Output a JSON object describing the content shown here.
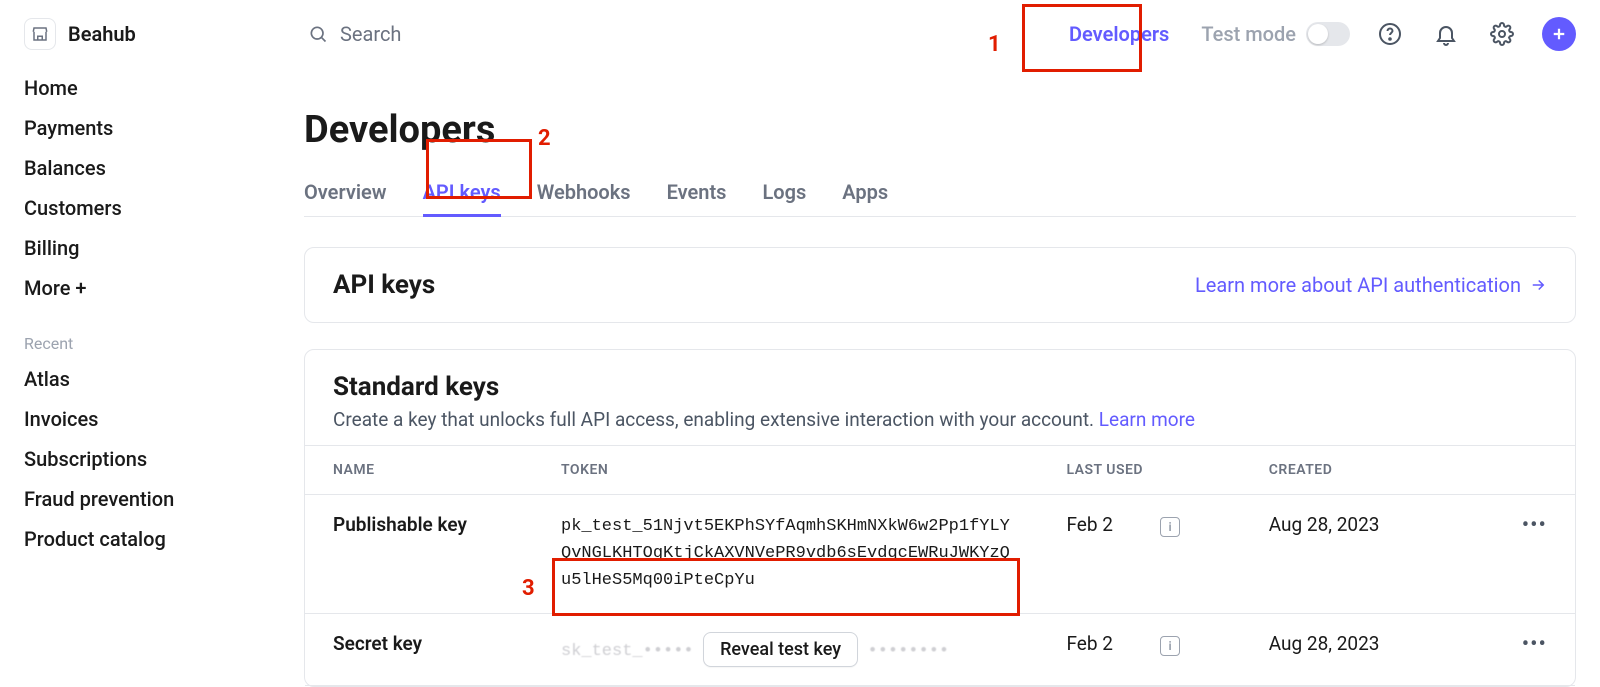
{
  "brand": "Beahub",
  "search": {
    "placeholder": "Search"
  },
  "topnav": {
    "developers": "Developers",
    "testmode": "Test mode"
  },
  "sidebar": {
    "items": [
      "Home",
      "Payments",
      "Balances",
      "Customers",
      "Billing",
      "More +"
    ],
    "recent_label": "Recent",
    "recent": [
      "Atlas",
      "Invoices",
      "Subscriptions",
      "Fraud prevention",
      "Product catalog"
    ]
  },
  "page": {
    "title": "Developers"
  },
  "tabs": [
    "Overview",
    "API keys",
    "Webhooks",
    "Events",
    "Logs",
    "Apps"
  ],
  "active_tab": 1,
  "apikeys_card": {
    "title": "API keys",
    "learn": "Learn more about API authentication"
  },
  "standard_card": {
    "title": "Standard keys",
    "subtitle": "Create a key that unlocks full API access, enabling extensive interaction with your account. ",
    "learn": "Learn more",
    "columns": [
      "NAME",
      "TOKEN",
      "LAST USED",
      "CREATED"
    ],
    "rows": [
      {
        "name": "Publishable key",
        "token": "pk_test_51Njvt5EKPhSYfAqmhSKHmNXkW6w2Pp1fYLYQvNGLKHTOgKtjCkAXVNVePR9vdb6sEvdqcEWRuJWKYzQu5lHeS5Mq00iPteCpYu",
        "last_used": "Feb 2",
        "created": "Aug 28, 2023"
      },
      {
        "name": "Secret key",
        "reveal_label": "Reveal test key",
        "last_used": "Feb 2",
        "created": "Aug 28, 2023"
      }
    ]
  },
  "annotations": {
    "1": "1",
    "2": "2",
    "3": "3"
  }
}
